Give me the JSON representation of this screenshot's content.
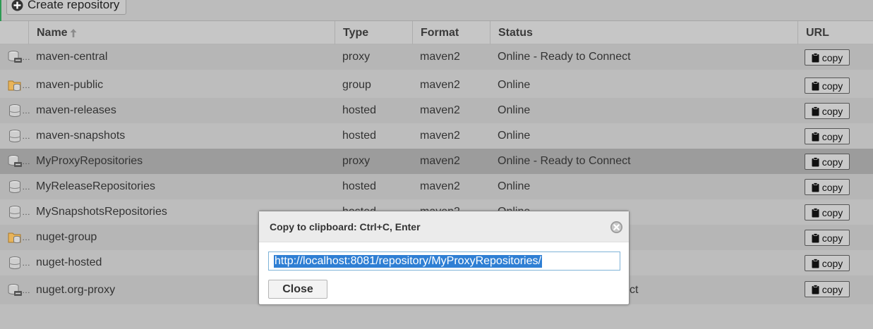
{
  "toolbar": {
    "create_label": "Create repository"
  },
  "columns": {
    "name": "Name",
    "type": "Type",
    "format": "Format",
    "status": "Status",
    "url": "URL"
  },
  "copy_label": "copy",
  "rows": [
    {
      "name": "maven-central",
      "type": "proxy",
      "format": "maven2",
      "status": "Online - Ready to Connect",
      "icon": "proxy-repo-icon"
    },
    {
      "name": "maven-public",
      "type": "group",
      "format": "maven2",
      "status": "Online",
      "icon": "group-repo-icon"
    },
    {
      "name": "maven-releases",
      "type": "hosted",
      "format": "maven2",
      "status": "Online",
      "icon": "hosted-repo-icon"
    },
    {
      "name": "maven-snapshots",
      "type": "hosted",
      "format": "maven2",
      "status": "Online",
      "icon": "hosted-repo-icon"
    },
    {
      "name": "MyProxyRepositories",
      "type": "proxy",
      "format": "maven2",
      "status": "Online - Ready to Connect",
      "icon": "proxy-repo-icon"
    },
    {
      "name": "MyReleaseRepositories",
      "type": "hosted",
      "format": "maven2",
      "status": "Online",
      "icon": "hosted-repo-icon"
    },
    {
      "name": "MySnapshotsRepositories",
      "type": "hosted",
      "format": "maven2",
      "status": "Online",
      "icon": "hosted-repo-icon"
    },
    {
      "name": "nuget-group",
      "type": "",
      "format": "",
      "status": "",
      "icon": "group-repo-icon"
    },
    {
      "name": "nuget-hosted",
      "type": "",
      "format": "",
      "status": "",
      "icon": "hosted-repo-icon"
    },
    {
      "name": "nuget.org-proxy",
      "type": "",
      "format": "",
      "status": "ct",
      "icon": "proxy-repo-icon"
    }
  ],
  "dialog": {
    "title": "Copy to clipboard: Ctrl+C, Enter",
    "url": "http://localhost:8081/repository/MyProxyRepositories/",
    "close_label": "Close"
  }
}
